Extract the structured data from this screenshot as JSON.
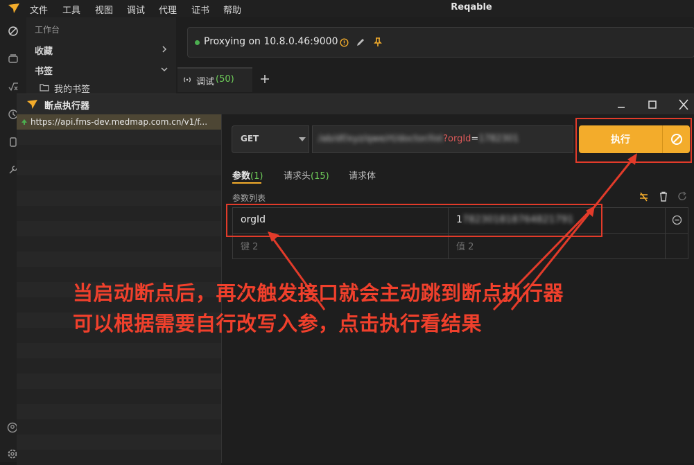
{
  "menubar": {
    "items": [
      "文件",
      "工具",
      "视图",
      "调试",
      "代理",
      "证书",
      "帮助"
    ],
    "app_title": "Reqable"
  },
  "sidebar": {
    "workbench_label": "工作台",
    "favorites_label": "收藏",
    "bookmarks_label": "书签",
    "my_bookmarks_label": "我的书签"
  },
  "proxy": {
    "status_text": "Proxying on 10.8.0.46:9000"
  },
  "tabs": {
    "debug_label": "调试",
    "debug_count": "(50)"
  },
  "dialog": {
    "title": "断点执行器",
    "request_url": "https://api.fms-dev.medmap.com.cn/v1/f...",
    "method": "GET",
    "url_param_key": "?orgId",
    "url_param_eq": "=",
    "exec_label": "执行",
    "subtabs": {
      "params_label": "参数",
      "params_count": "(1)",
      "headers_label": "请求头",
      "headers_count": "(15)",
      "body_label": "请求体"
    },
    "param_list_label": "参数列表",
    "params": [
      {
        "key": "orgId",
        "value": "1"
      }
    ],
    "key_placeholder": "键 2",
    "value_placeholder": "值 2"
  },
  "annotation": {
    "line1": "当启动断点后，再次触发接口就会主动跳到断点执行器",
    "line2": "可以根据需要自行改写入参，点击执行看结果"
  },
  "colors": {
    "accent": "#f3ac2b",
    "annotation_red": "#e23b2a",
    "proxy_dot": "#4caf50",
    "count_green": "#6fcf5a"
  }
}
